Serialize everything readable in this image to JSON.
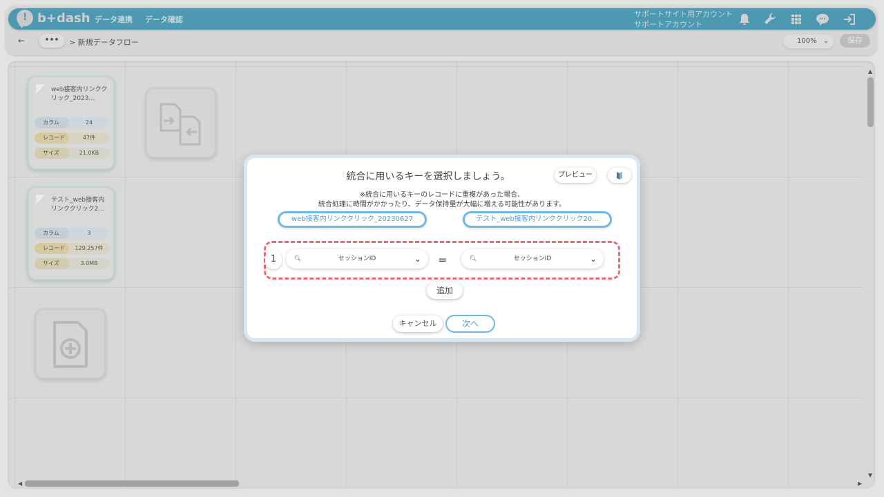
{
  "header": {
    "logo_text": "b+dash",
    "nav": [
      "データ連携",
      "データ確認"
    ],
    "account_line1": "サポートサイト用アカウント",
    "account_line2": "サポートアカウント",
    "icons": [
      "bell-icon",
      "wrench-icon",
      "grid-icon",
      "chat-icon",
      "logout-icon"
    ]
  },
  "toolbar": {
    "back": "←",
    "more": "•••",
    "breadcrumb": "> 新規データフロー",
    "zoom": "100%",
    "save_label": "保存"
  },
  "cards": [
    {
      "title": "web接客内リンククリック_2023…",
      "rows": [
        {
          "k": "カラム",
          "v": "24"
        },
        {
          "k": "レコード",
          "v": "47件"
        },
        {
          "k": "サイズ",
          "v": "21.0KB"
        }
      ]
    },
    {
      "title": "テスト_web接客内リンククリック2…",
      "rows": [
        {
          "k": "カラム",
          "v": "3"
        },
        {
          "k": "レコード",
          "v": "129,257件"
        },
        {
          "k": "サイズ",
          "v": "3.0MB"
        }
      ]
    }
  ],
  "modal": {
    "title": "統合に用いるキーを選択しましょう。",
    "preview_label": "プレビュー",
    "note_line1": "※統合に用いるキーのレコードに重複があった場合、",
    "note_line2": "統合処理に時間がかかったり、データ保持量が大幅に増える可能性があります。",
    "left_table": "web接客内リンククリック_20230627",
    "right_table": "テスト_web接客内リンククリック20...",
    "key_index": "1",
    "left_key": "セッションID",
    "right_key": "セッションID",
    "equals": "=",
    "add_label": "追加",
    "cancel_label": "キャンセル",
    "next_label": "次へ",
    "accent_color": "#6db8e5",
    "dashed_color": "#e86b76"
  }
}
